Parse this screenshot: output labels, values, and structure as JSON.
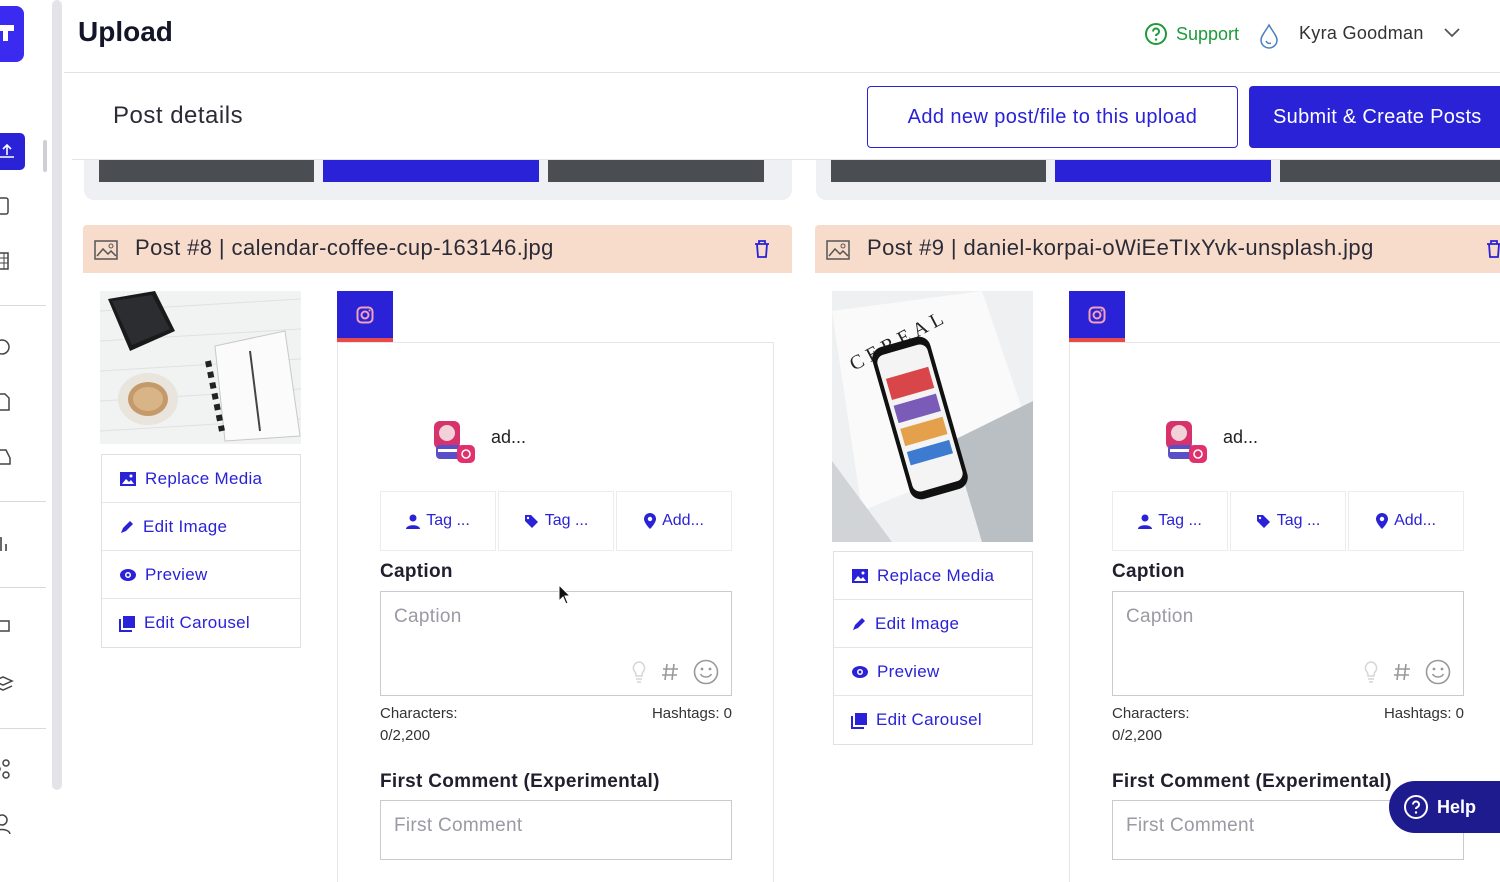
{
  "header": {
    "title": "Upload",
    "support_label": "Support",
    "user_name": "Kyra Goodman"
  },
  "subheader": {
    "title": "Post details",
    "add_button": "Add new post/file to this upload",
    "submit_button": "Submit & Create Posts"
  },
  "posts": [
    {
      "title": "Post #8 | calendar-coffee-cup-163146.jpg",
      "account": "ad...",
      "actions": [
        "Replace Media",
        "Edit Image",
        "Preview",
        "Edit Carousel"
      ],
      "tags": [
        "Tag ...",
        "Tag ...",
        "Add..."
      ],
      "caption_label": "Caption",
      "caption_placeholder": "Caption",
      "characters_label": "Characters:",
      "characters_value": "0/2,200",
      "hashtags": "Hashtags: 0",
      "first_comment_label": "First Comment (Experimental)",
      "first_comment_placeholder": "First Comment"
    },
    {
      "title": "Post #9 | daniel-korpai-oWiEeTIxYvk-unsplash.jpg",
      "account": "ad...",
      "actions": [
        "Replace Media",
        "Edit Image",
        "Preview",
        "Edit Carousel"
      ],
      "tags": [
        "Tag ...",
        "Tag ...",
        "Add..."
      ],
      "caption_label": "Caption",
      "caption_placeholder": "Caption",
      "characters_label": "Characters:",
      "characters_value": "0/2,200",
      "hashtags": "Hashtags: 0",
      "first_comment_label": "First Comment (Experimental)",
      "first_comment_placeholder": "First Comment"
    }
  ],
  "thumb2_text": "CEREAL",
  "help_label": "Help",
  "colors": {
    "primary": "#2a22d6",
    "header_bg": "#f8dccb",
    "support": "#1e9a3a",
    "help_bg": "#1e1b8f"
  }
}
